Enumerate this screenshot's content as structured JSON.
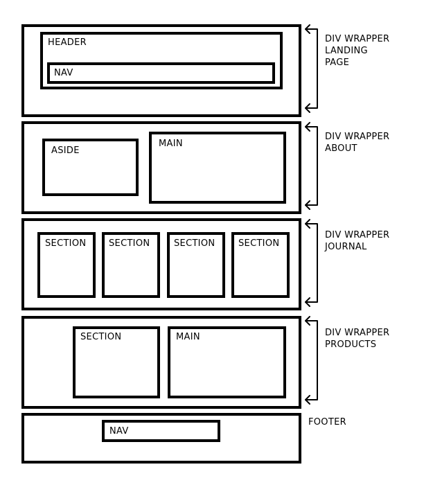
{
  "wrappers": {
    "landing": {
      "label_lines": [
        "DIV WRAPPER",
        "LANDING",
        "PAGE"
      ],
      "header": "HEADER",
      "nav": "NAV"
    },
    "about": {
      "label_lines": [
        "DIV WRAPPER",
        "ABOUT"
      ],
      "aside": "ASIDE",
      "main": "MAIN"
    },
    "journal": {
      "label_lines": [
        "DIV WRAPPER",
        "JOURNAL"
      ],
      "sections": [
        "SECTION",
        "SECTION",
        "SECTION",
        "SECTION"
      ]
    },
    "products": {
      "label_lines": [
        "DIV WRAPPER",
        "PRODUCTS"
      ],
      "section": "SECTION",
      "main": "MAIN"
    }
  },
  "footer": {
    "label": "FOOTER",
    "nav": "NAV"
  },
  "colors": {
    "stroke": "#000000",
    "background": "#ffffff"
  }
}
